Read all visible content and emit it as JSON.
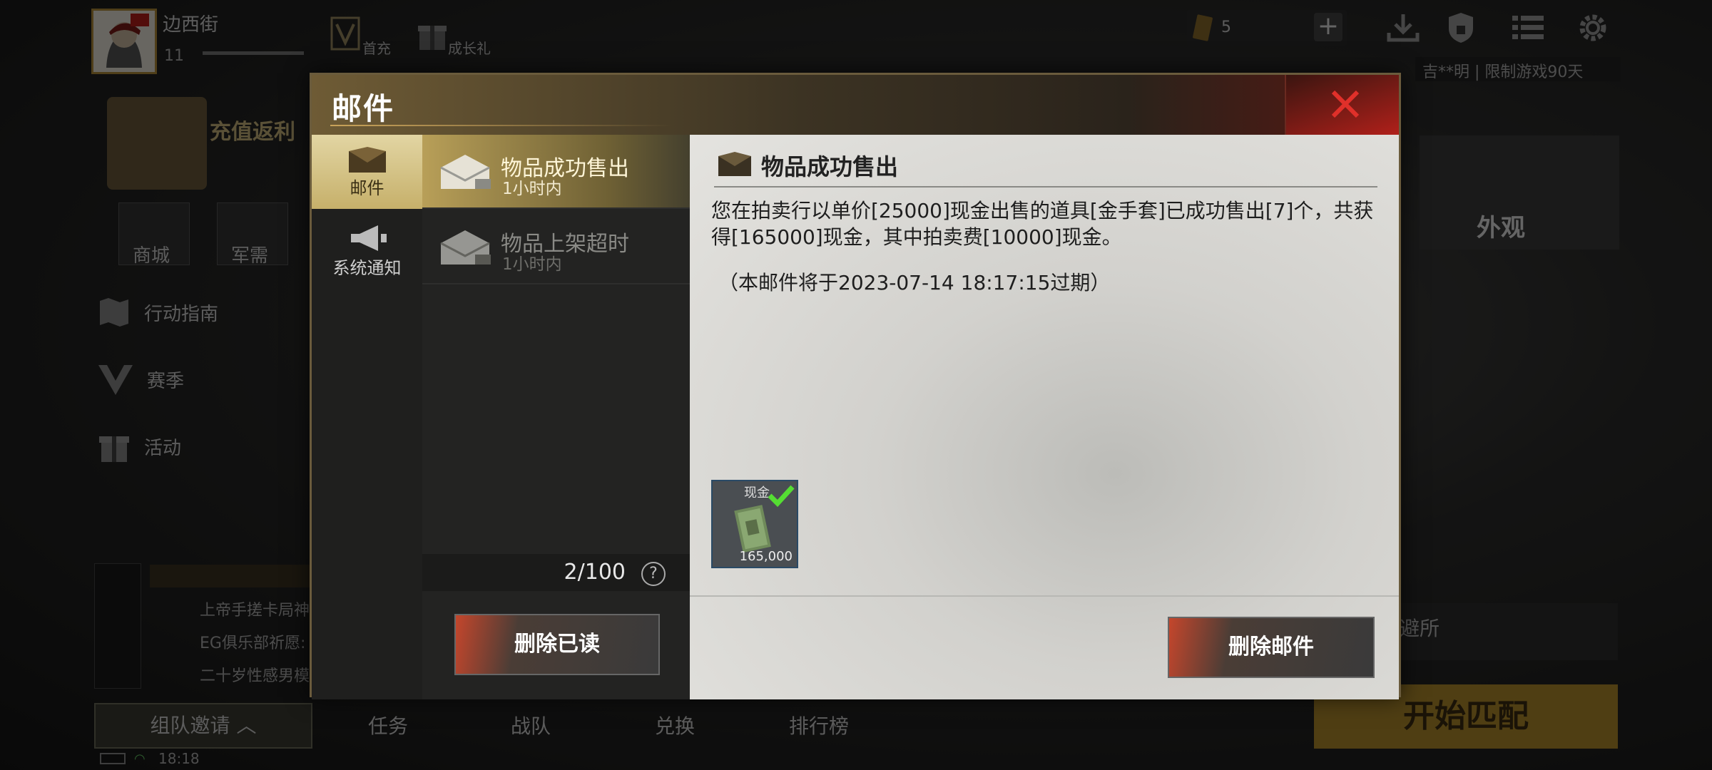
{
  "player": {
    "name": "边西街",
    "level": "11"
  },
  "top_icons": [
    {
      "icon": "v-badge-icon",
      "label": "首充"
    },
    {
      "icon": "gift-icon",
      "label": "成长礼"
    }
  ],
  "resource": {
    "count": "5"
  },
  "notice": "吉**明 | 限制游戏90天",
  "left_menu": {
    "recharge": "充值返利",
    "shop": "商城",
    "supply": "军需",
    "items": [
      {
        "icon": "map-icon",
        "label": "行动指南"
      },
      {
        "icon": "season-v-icon",
        "label": "赛季"
      },
      {
        "icon": "gift-icon",
        "label": "活动"
      }
    ]
  },
  "right_panel": {
    "appearance": "外观",
    "shelter": "避所",
    "start_match": "开始匹配"
  },
  "chat": [
    {
      "text": "上帝手搓卡局神"
    },
    {
      "text": "EG俱乐部祈愿:"
    },
    {
      "text": "二十岁性感男模"
    }
  ],
  "bottom": {
    "team_invite": "组队邀请",
    "tabs": [
      "任务",
      "战队",
      "兑换",
      "排行榜"
    ],
    "time": "18:18"
  },
  "mail": {
    "title": "邮件",
    "categories": [
      {
        "icon": "envelope-icon",
        "label": "邮件",
        "active": true
      },
      {
        "icon": "megaphone-icon",
        "label": "系统通知",
        "active": false
      }
    ],
    "list": [
      {
        "title": "物品成功售出",
        "time": "1小时内",
        "active": true
      },
      {
        "title": "物品上架超时",
        "time": "1小时内",
        "active": false
      }
    ],
    "count": "2/100",
    "delete_read": "删除已读",
    "detail": {
      "title": "物品成功售出",
      "body": "您在拍卖行以单价[25000]现金出售的道具[金手套]已成功售出[7]个，共获得[165000]现金，其中拍卖费[10000]现金。",
      "expire": "（本邮件将于2023-07-14 18:17:15过期）",
      "attachment": {
        "label": "现金",
        "quantity": "165,000",
        "claimed": true
      }
    },
    "delete_mail": "删除邮件"
  },
  "colors": {
    "accent_gold": "#c6b06a",
    "close_red": "#e0302a",
    "check_green": "#55dd33"
  }
}
